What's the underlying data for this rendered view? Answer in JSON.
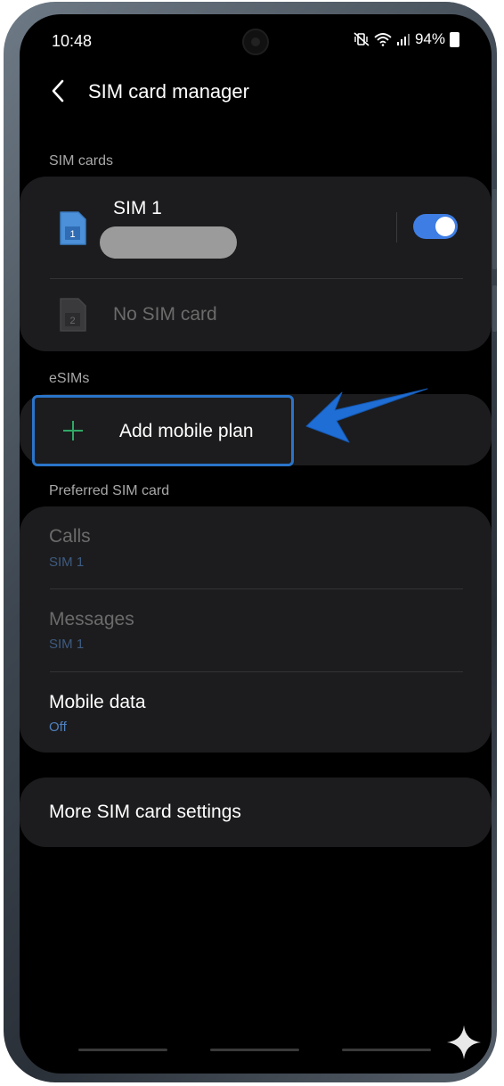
{
  "status_bar": {
    "time": "10:48",
    "battery": "94%",
    "icons": [
      "mute-vibrate-icon",
      "wifi-icon",
      "signal-icon",
      "battery-icon"
    ]
  },
  "header": {
    "title": "SIM card manager",
    "back_icon": "chevron-left-icon"
  },
  "sections": {
    "sim_cards": "SIM cards",
    "esims": "eSIMs",
    "preferred": "Preferred SIM card"
  },
  "sim_cards": [
    {
      "name": "SIM 1",
      "slot": "1",
      "number_hidden": true,
      "enabled": true
    },
    {
      "name": "No SIM card",
      "slot": "2",
      "empty": true
    }
  ],
  "esims": {
    "add_label": "Add mobile plan"
  },
  "preferred": [
    {
      "title": "Calls",
      "value": "SIM 1",
      "disabled": true
    },
    {
      "title": "Messages",
      "value": "SIM 1",
      "disabled": true
    },
    {
      "title": "Mobile data",
      "value": "Off",
      "disabled": false
    }
  ],
  "more_settings": {
    "label": "More SIM card settings"
  },
  "colors": {
    "accent": "#3e7de4",
    "highlight_border": "#2a74c9",
    "arrow": "#1f6ed6",
    "card_bg": "#1c1c1e",
    "subtext_blue": "#4f80bf"
  }
}
